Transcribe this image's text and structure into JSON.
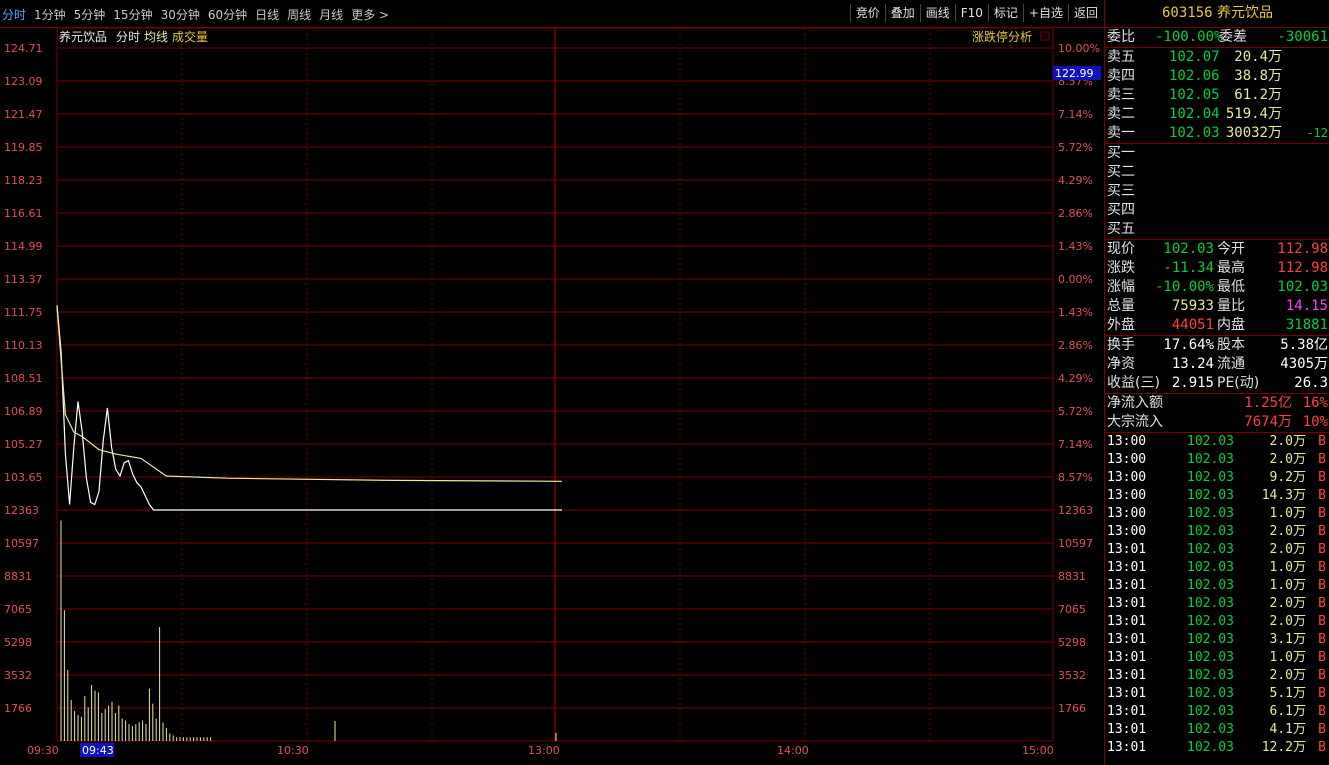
{
  "toolbar": {
    "periods": [
      "分时",
      "1分钟",
      "5分钟",
      "15分钟",
      "30分钟",
      "60分钟",
      "日线",
      "周线",
      "月线",
      "更多 >"
    ],
    "active": "分时",
    "tools": [
      "竞价",
      "叠加",
      "画线",
      "F10",
      "标记",
      "+自选",
      "返回"
    ]
  },
  "chart": {
    "legend": [
      "养元饮品",
      "分时",
      "均线",
      "成交量"
    ],
    "limit_label": "涨跌停分析",
    "price_ticks": [
      "124.71",
      "123.09",
      "121.47",
      "119.85",
      "118.23",
      "116.61",
      "114.99",
      "113.37",
      "111.75",
      "110.13",
      "108.51",
      "106.89",
      "105.27",
      "103.65"
    ],
    "pct_ticks": [
      "10.00%",
      "8.57%",
      "7.14%",
      "5.72%",
      "4.29%",
      "2.86%",
      "1.43%",
      "0.00%",
      "1.43%",
      "2.86%",
      "4.29%",
      "5.72%",
      "7.14%",
      "8.57%"
    ],
    "vol_ticks": [
      "12363",
      "10597",
      "8831",
      "7065",
      "5298",
      "3532",
      "1766"
    ],
    "time_labels": [
      "09:30",
      "09:43",
      "10:30",
      "13:00",
      "14:00",
      "15:00"
    ],
    "current_price_tag": "122.99"
  },
  "chart_data": {
    "type": "line",
    "title": "养元饮品 分时",
    "ylim": [
      103.65,
      124.71
    ],
    "series": [
      {
        "name": "分时",
        "x": [
          0,
          1,
          2,
          3,
          4,
          5,
          6,
          7,
          8,
          9,
          10,
          11,
          12,
          13,
          14,
          15,
          16,
          17,
          18,
          19,
          20,
          21,
          22,
          23,
          24,
          25,
          26,
          30,
          40,
          60,
          100,
          120
        ],
        "values": [
          112.98,
          110.8,
          106.2,
          103.9,
          106.5,
          108.6,
          107.2,
          105.1,
          104.0,
          103.9,
          104.5,
          106.8,
          108.3,
          106.5,
          105.5,
          105.2,
          105.8,
          105.9,
          105.3,
          104.9,
          104.7,
          104.3,
          103.9,
          103.6,
          103.4,
          103.0,
          102.03,
          102.03,
          102.03,
          102.03,
          102.03,
          102.03
        ]
      },
      {
        "name": "均线",
        "x": [
          0,
          2,
          4,
          6,
          10,
          14,
          20,
          26,
          40,
          80,
          120
        ],
        "values": [
          112.9,
          108.0,
          107.2,
          107.0,
          106.4,
          106.2,
          106.0,
          105.2,
          105.1,
          105.0,
          104.96
        ]
      }
    ],
    "volume": [
      11800,
      7000,
      3800,
      2200,
      1600,
      1400,
      1300,
      2400,
      1800,
      3000,
      2700,
      2600,
      1500,
      1700,
      1900,
      2100,
      1500,
      1900,
      1200,
      1100,
      900,
      800,
      900,
      1000,
      1100,
      900,
      2800,
      2000,
      1200,
      6100,
      1000,
      700,
      400,
      300,
      200,
      200,
      200,
      200,
      200,
      200,
      200,
      200,
      200,
      200,
      200
    ]
  },
  "panel": {
    "code": "603156",
    "name": "养元饮品",
    "weibi_label": "委比",
    "weibi": "-100.00%",
    "weicha_label": "委差",
    "weicha": "-30061",
    "asks": [
      {
        "label": "卖五",
        "price": "102.07",
        "vol": "20.4万",
        "chg": ""
      },
      {
        "label": "卖四",
        "price": "102.06",
        "vol": "38.8万",
        "chg": ""
      },
      {
        "label": "卖三",
        "price": "102.05",
        "vol": "61.2万",
        "chg": ""
      },
      {
        "label": "卖二",
        "price": "102.04",
        "vol": "519.4万",
        "chg": ""
      },
      {
        "label": "卖一",
        "price": "102.03",
        "vol": "30032万",
        "chg": "-12"
      }
    ],
    "bids": [
      "买一",
      "买二",
      "买三",
      "买四",
      "买五"
    ],
    "stats": [
      [
        "现价",
        "102.03",
        "今开",
        "112.98"
      ],
      [
        "涨跌",
        "-11.34",
        "最高",
        "112.98"
      ],
      [
        "涨幅",
        "-10.00%",
        "最低",
        "102.03"
      ],
      [
        "总量",
        "75933",
        "量比",
        "14.15"
      ],
      [
        "外盘",
        "44051",
        "内盘",
        "31881"
      ]
    ],
    "stats2": [
      [
        "换手",
        "17.64%",
        "股本",
        "5.38亿"
      ],
      [
        "净资",
        "13.24",
        "流通",
        "4305万"
      ],
      [
        "收益(三)",
        "2.915",
        "PE(动)",
        "26.3"
      ]
    ],
    "flow": [
      [
        "净流入额",
        "1.25亿",
        "16%"
      ],
      [
        "大宗流入",
        "7674万",
        "10%"
      ]
    ],
    "trades": [
      [
        "13:00",
        "102.03",
        "2.0万",
        "B"
      ],
      [
        "13:00",
        "102.03",
        "2.0万",
        "B"
      ],
      [
        "13:00",
        "102.03",
        "9.2万",
        "B"
      ],
      [
        "13:00",
        "102.03",
        "14.3万",
        "B"
      ],
      [
        "13:00",
        "102.03",
        "1.0万",
        "B"
      ],
      [
        "13:00",
        "102.03",
        "2.0万",
        "B"
      ],
      [
        "13:01",
        "102.03",
        "2.0万",
        "B"
      ],
      [
        "13:01",
        "102.03",
        "1.0万",
        "B"
      ],
      [
        "13:01",
        "102.03",
        "1.0万",
        "B"
      ],
      [
        "13:01",
        "102.03",
        "2.0万",
        "B"
      ],
      [
        "13:01",
        "102.03",
        "2.0万",
        "B"
      ],
      [
        "13:01",
        "102.03",
        "3.1万",
        "B"
      ],
      [
        "13:01",
        "102.03",
        "1.0万",
        "B"
      ],
      [
        "13:01",
        "102.03",
        "2.0万",
        "B"
      ],
      [
        "13:01",
        "102.03",
        "5.1万",
        "B"
      ],
      [
        "13:01",
        "102.03",
        "6.1万",
        "B"
      ],
      [
        "13:01",
        "102.03",
        "4.1万",
        "B"
      ],
      [
        "13:01",
        "102.03",
        "12.2万",
        "B"
      ]
    ],
    "colors": {
      "up": "#ff4040",
      "down": "#00d040",
      "grid": "#7a0000"
    }
  }
}
